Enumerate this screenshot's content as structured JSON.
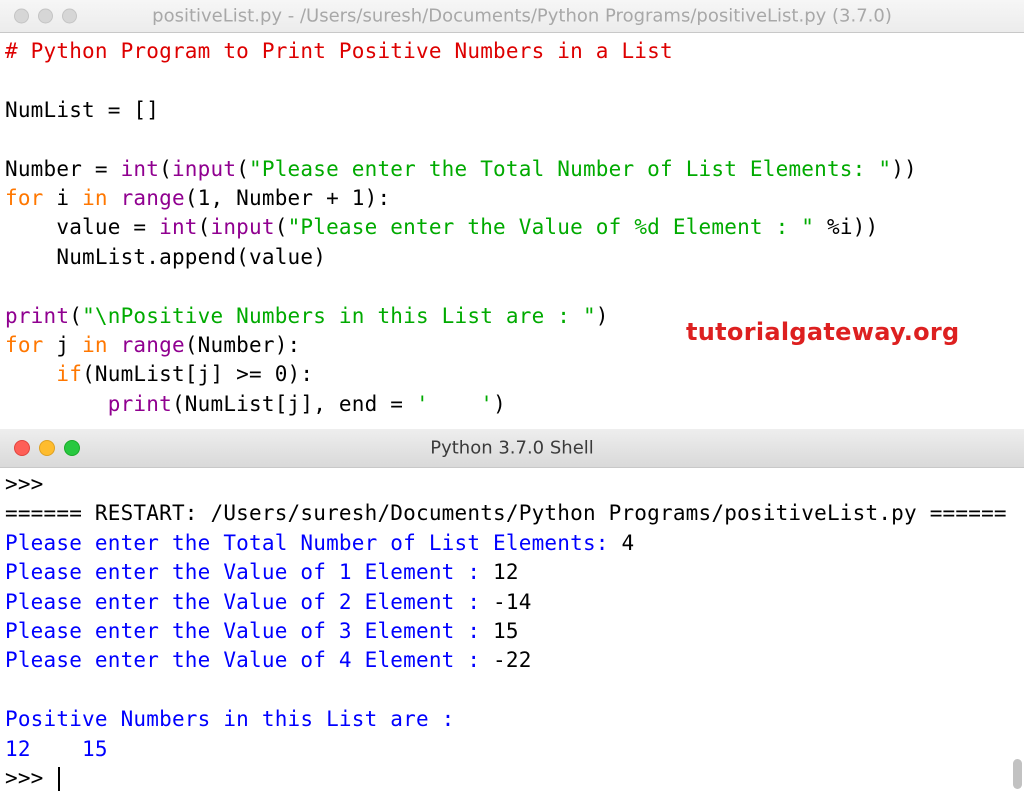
{
  "editor": {
    "title": "positiveList.py - /Users/suresh/Documents/Python Programs/positiveList.py (3.7.0)",
    "watermark": "tutorialgateway.org",
    "lines": [
      [
        {
          "t": "# Python Program to Print Positive Numbers in a List",
          "c": "c"
        }
      ],
      [],
      [
        {
          "t": "NumList = []",
          "c": ""
        }
      ],
      [],
      [
        {
          "t": "Number = ",
          "c": ""
        },
        {
          "t": "int",
          "c": "b"
        },
        {
          "t": "(",
          "c": ""
        },
        {
          "t": "input",
          "c": "b"
        },
        {
          "t": "(",
          "c": ""
        },
        {
          "t": "\"Please enter the Total Number of List Elements: \"",
          "c": "s"
        },
        {
          "t": "))",
          "c": ""
        }
      ],
      [
        {
          "t": "for",
          "c": "k"
        },
        {
          "t": " i ",
          "c": ""
        },
        {
          "t": "in",
          "c": "k"
        },
        {
          "t": " ",
          "c": ""
        },
        {
          "t": "range",
          "c": "b"
        },
        {
          "t": "(1, Number + 1):",
          "c": ""
        }
      ],
      [
        {
          "t": "    value = ",
          "c": ""
        },
        {
          "t": "int",
          "c": "b"
        },
        {
          "t": "(",
          "c": ""
        },
        {
          "t": "input",
          "c": "b"
        },
        {
          "t": "(",
          "c": ""
        },
        {
          "t": "\"Please enter the Value of %d Element : \"",
          "c": "s"
        },
        {
          "t": " %i))",
          "c": ""
        }
      ],
      [
        {
          "t": "    NumList.append(value)",
          "c": ""
        }
      ],
      [],
      [
        {
          "t": "print",
          "c": "b"
        },
        {
          "t": "(",
          "c": ""
        },
        {
          "t": "\"\\nPositive Numbers in this List are : \"",
          "c": "s"
        },
        {
          "t": ")",
          "c": ""
        }
      ],
      [
        {
          "t": "for",
          "c": "k"
        },
        {
          "t": " j ",
          "c": ""
        },
        {
          "t": "in",
          "c": "k"
        },
        {
          "t": " ",
          "c": ""
        },
        {
          "t": "range",
          "c": "b"
        },
        {
          "t": "(Number):",
          "c": ""
        }
      ],
      [
        {
          "t": "    ",
          "c": ""
        },
        {
          "t": "if",
          "c": "k"
        },
        {
          "t": "(NumList[j] >= 0):",
          "c": ""
        }
      ],
      [
        {
          "t": "        ",
          "c": ""
        },
        {
          "t": "print",
          "c": "b"
        },
        {
          "t": "(NumList[j], end = ",
          "c": ""
        },
        {
          "t": "'    '",
          "c": "s"
        },
        {
          "t": ")",
          "c": ""
        }
      ]
    ]
  },
  "shell": {
    "title": "Python 3.7.0 Shell",
    "lines": [
      [
        {
          "t": ">>> ",
          "c": ""
        }
      ],
      [
        {
          "t": "====== RESTART: /Users/suresh/Documents/Python Programs/positiveList.py ======",
          "c": ""
        }
      ],
      [
        {
          "t": "Please enter the Total Number of List Elements: ",
          "c": "blue"
        },
        {
          "t": "4",
          "c": ""
        }
      ],
      [
        {
          "t": "Please enter the Value of 1 Element : ",
          "c": "blue"
        },
        {
          "t": "12",
          "c": ""
        }
      ],
      [
        {
          "t": "Please enter the Value of 2 Element : ",
          "c": "blue"
        },
        {
          "t": "-14",
          "c": ""
        }
      ],
      [
        {
          "t": "Please enter the Value of 3 Element : ",
          "c": "blue"
        },
        {
          "t": "15",
          "c": ""
        }
      ],
      [
        {
          "t": "Please enter the Value of 4 Element : ",
          "c": "blue"
        },
        {
          "t": "-22",
          "c": ""
        }
      ],
      [],
      [
        {
          "t": "Positive Numbers in this List are : ",
          "c": "blue"
        }
      ],
      [
        {
          "t": "12    15    ",
          "c": "blue"
        }
      ],
      [
        {
          "t": ">>> ",
          "c": ""
        }
      ]
    ]
  },
  "colors": {
    "keyword": "#ff7700",
    "builtin": "#900090",
    "string": "#00aa00",
    "comment": "#dd0000",
    "stdout": "#0000ff",
    "watermark": "#dd2020"
  }
}
